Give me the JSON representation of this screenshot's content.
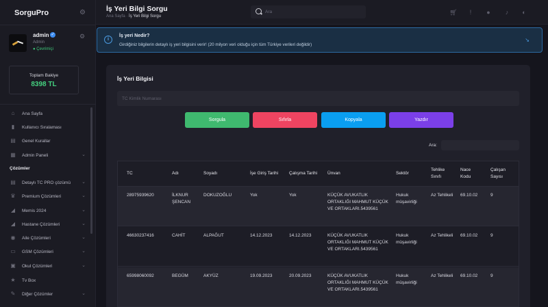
{
  "brand": "SorguPro",
  "user": {
    "name": "admin",
    "role": "Admin",
    "status": "● Çevrimiçi"
  },
  "balance": {
    "label": "Toplam Bakiye",
    "value": "8398 TL"
  },
  "nav": {
    "items_top": [
      "Ana Sayfa",
      "Kullanıcı Sıralaması",
      "Genel Kurallar",
      "Admin Paneli"
    ],
    "section": "Çözümler",
    "items_bottom": [
      "Detaylı TC PRO çözümü",
      "Premium Çözümleri",
      "Memis 2024",
      "Hastane Çözümleri",
      "Aile Çözümleri",
      "GSM Çözümleri",
      "Okul Çözümleri",
      "Tv Box",
      "Diğer Çözümler"
    ]
  },
  "header": {
    "title": "İş Yeri Bilgi Sorgu",
    "breadcrumb_home": "Ana Sayfa",
    "breadcrumb_sep": "·",
    "breadcrumb_current": "İş Yeri Bilgi Sorgu",
    "search_placeholder": "Ara"
  },
  "banner": {
    "title": "İş yeri Nedir?",
    "text": "Girdiğiniz bilgilerin detaylı iş yeri bilgisini verir! (20 milyon veri olduğu için tüm Türkiye verileri değildir)"
  },
  "card": {
    "title": "İş Yeri Bilgisi",
    "tc_placeholder": "TC Kimlik Numarası",
    "buttons": {
      "sorgula": "Sorgula",
      "sifirla": "Sıfırla",
      "kopyala": "Kopyala",
      "yazdir": "Yazdır"
    },
    "search_label": "Ara:"
  },
  "table": {
    "headers": [
      "TC",
      "Adı",
      "Soyadı",
      "İşe Giriş Tarihi",
      "Çalışma Tarihi",
      "Ünvan",
      "Sektör",
      "Tehlike Sınıfı",
      "Nace Kodu",
      "Çalışan Sayısı"
    ],
    "rows": [
      [
        "28975939620",
        "İLKNUR ŞENCAN",
        "DOKUZOĞLU",
        "Yok",
        "Yok",
        "KÜÇÜK AVUKATLIK ORTAKLIĞI MAHMUT KÜÇÜK VE ORTAKLARI.5439561",
        "Hukuk müşavirliği",
        "Az Tehlikeli",
        "69.10.02",
        "9"
      ],
      [
        "46630237416",
        "CAHİT",
        "ALPAĞUT",
        "14.12.2023",
        "14.12.2023",
        "KÜÇÜK AVUKATLIK ORTAKLIĞI MAHMUT KÜÇÜK VE ORTAKLARI.5439561",
        "Hukuk müşavirliği",
        "Az Tehlikeli",
        "69.10.02",
        "9"
      ],
      [
        "65998060092",
        "BEGÜM",
        "AKYÜZ",
        "19.09.2023",
        "20.09.2023",
        "KÜÇÜK AVUKATLIK ORTAKLIĞI MAHMUT KÜÇÜK VE ORTAKLARI.5439561",
        "Hukuk müşavirliği",
        "Az Tehlikeli",
        "69.10.02",
        "9"
      ]
    ]
  },
  "colors": {
    "green": "#3fb96f",
    "red": "#ef4461",
    "blue": "#0a9ef0",
    "purple": "#7b3fe8",
    "balance": "#45d07f"
  }
}
